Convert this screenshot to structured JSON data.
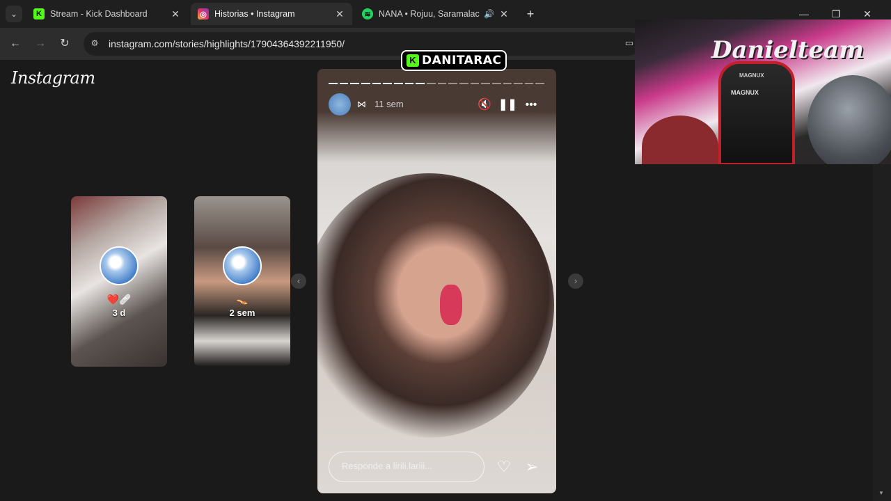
{
  "browser": {
    "tabs": [
      {
        "title": "Stream - Kick Dashboard",
        "active": false
      },
      {
        "title": "Historias • Instagram",
        "active": true
      },
      {
        "title": "NANA • Rojuu, Saramalacara",
        "active": false
      }
    ],
    "url": "instagram.com/stories/highlights/17904364392211950/"
  },
  "instagram": {
    "logo": "Instagram",
    "side_stories": [
      {
        "emoji": "❤️🩹",
        "age": "3 d"
      },
      {
        "emoji": "👡",
        "age": "2 sem"
      }
    ],
    "story": {
      "progress_total": 20,
      "progress_done": 9,
      "time": "11 sem",
      "reply_placeholder": "Responde a lirili.lariii..."
    }
  },
  "stream_overlay": {
    "channel": "DANITARAC",
    "webcam_graffiti": "Danielteam",
    "chair_brand": "MAGNUX"
  },
  "colors": {
    "kick_green": "#53fc18",
    "lips": "#d63a58"
  }
}
